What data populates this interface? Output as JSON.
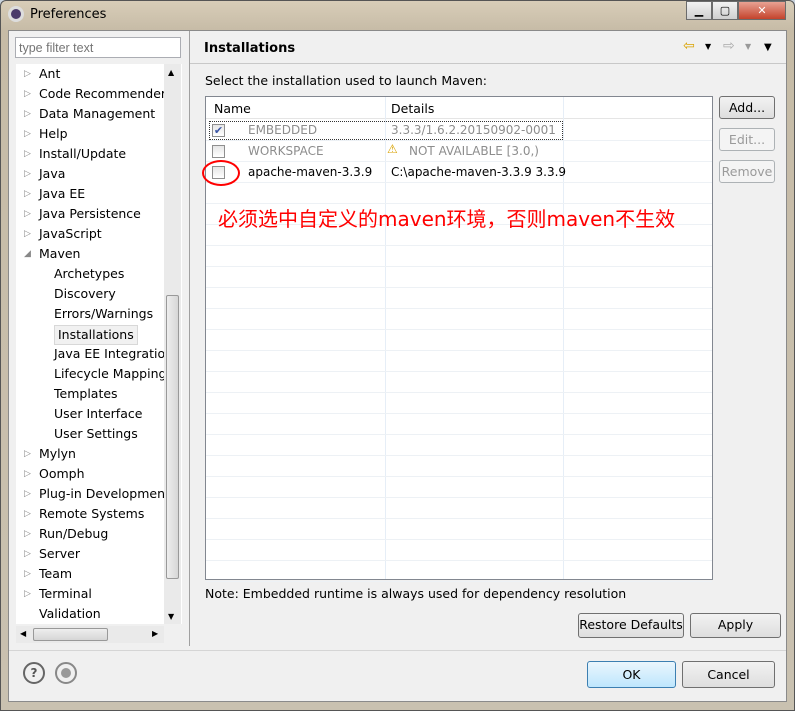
{
  "window": {
    "title": "Preferences",
    "buttons": [
      "minimize",
      "maximize",
      "close"
    ]
  },
  "filter": {
    "placeholder": "type filter text"
  },
  "tree": [
    {
      "label": "Ant",
      "expandable": true
    },
    {
      "label": "Code Recommenders",
      "expandable": true
    },
    {
      "label": "Data Management",
      "expandable": true
    },
    {
      "label": "Help",
      "expandable": true
    },
    {
      "label": "Install/Update",
      "expandable": true
    },
    {
      "label": "Java",
      "expandable": true
    },
    {
      "label": "Java EE",
      "expandable": true
    },
    {
      "label": "Java Persistence",
      "expandable": true
    },
    {
      "label": "JavaScript",
      "expandable": true
    },
    {
      "label": "Maven",
      "expanded": true
    },
    {
      "label": "Archetypes",
      "child": true
    },
    {
      "label": "Discovery",
      "child": true
    },
    {
      "label": "Errors/Warnings",
      "child": true
    },
    {
      "label": "Installations",
      "child": true,
      "selected": true
    },
    {
      "label": "Java EE Integration",
      "child": true
    },
    {
      "label": "Lifecycle Mapping",
      "child": true
    },
    {
      "label": "Templates",
      "child": true
    },
    {
      "label": "User Interface",
      "child": true
    },
    {
      "label": "User Settings",
      "child": true
    },
    {
      "label": "Mylyn",
      "expandable": true
    },
    {
      "label": "Oomph",
      "expandable": true
    },
    {
      "label": "Plug-in Development",
      "expandable": true
    },
    {
      "label": "Remote Systems",
      "expandable": true
    },
    {
      "label": "Run/Debug",
      "expandable": true
    },
    {
      "label": "Server",
      "expandable": true
    },
    {
      "label": "Team",
      "expandable": true
    },
    {
      "label": "Terminal",
      "expandable": true
    },
    {
      "label": "Validation"
    }
  ],
  "page": {
    "title": "Installations",
    "instruction": "Select the installation used to launch Maven:",
    "columns": [
      "Name",
      "Details"
    ],
    "rows": [
      {
        "name": "EMBEDDED",
        "details": "3.3.3/1.6.2.20150902-0001",
        "checked": true,
        "disabled": true
      },
      {
        "name": "WORKSPACE",
        "details": "NOT AVAILABLE [3.0,)",
        "checked": false,
        "disabled": true,
        "warning": true
      },
      {
        "name": "apache-maven-3.3.9",
        "details": "C:\\apache-maven-3.3.9 3.3.9",
        "checked": false
      }
    ],
    "annotation": "必须选中自定义的maven环境，否则maven不生效",
    "note": "Note: Embedded runtime is always used for dependency resolution",
    "buttons": {
      "add": "Add...",
      "edit": "Edit...",
      "remove": "Remove",
      "restore": "Restore Defaults",
      "apply": "Apply"
    }
  },
  "footer": {
    "ok": "OK",
    "cancel": "Cancel"
  },
  "colors": {
    "annotation": "#ff0000"
  }
}
